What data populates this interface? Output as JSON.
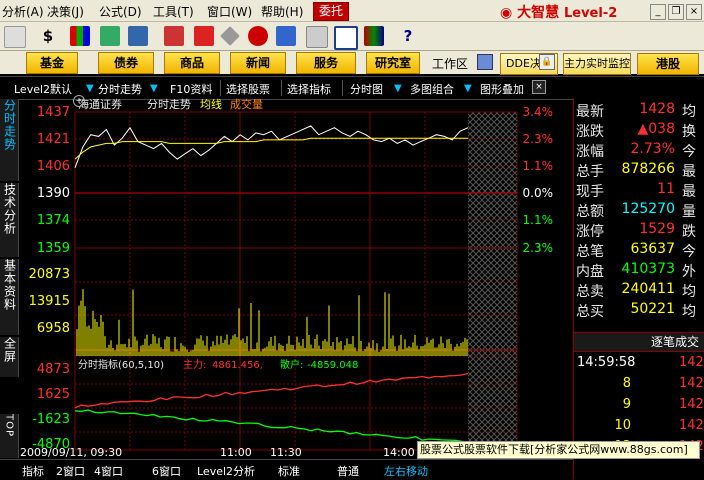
{
  "menu": {
    "items": [
      "分析(A)",
      "决策(J)",
      "公式(D)",
      "工具(T)",
      "窗口(W)",
      "帮助(H)"
    ],
    "entrust": "委托",
    "logo": "大智慧",
    "logo_level": "Level-2"
  },
  "toolbar": {
    "icons": [
      "ruler-icon",
      "dollar-icon",
      "quote-icon",
      "chart-icon",
      "news-icon",
      "flag-icon",
      "diamond-icon",
      "ie-icon",
      "lock-icon",
      "window-icon",
      "table-icon",
      "book-icon",
      "help-icon"
    ]
  },
  "nav": {
    "buttons": [
      "基金",
      "债券",
      "商品",
      "新闻",
      "服务",
      "研究室"
    ],
    "workarea": "工作区",
    "dde": "DDE决策",
    "realtime": "主力实时监控",
    "hk": "港股"
  },
  "funcbar": {
    "items": [
      "Level2默认",
      "分时走势",
      "F10资料",
      "选择股票",
      "选择指标",
      "分时图",
      "多图组合",
      "图形叠加"
    ]
  },
  "left_tabs": [
    "分时走势",
    "技术分析",
    "基本资料",
    "全屏",
    "TOP"
  ],
  "chart": {
    "stock_name": "海通证券",
    "view_name": "分时走势",
    "legend_avg": "均线",
    "legend_vol": "成交量",
    "price_ticks": [
      "1437",
      "1421",
      "1406",
      "1390",
      "1374",
      "1359"
    ],
    "pct_ticks": [
      "3.4%",
      "2.3%",
      "1.1%",
      "0.0%",
      "1.1%",
      "2.3%"
    ],
    "vol_ticks": [
      "20873",
      "13915",
      "6958"
    ],
    "indicator_title": "分时指标(60,5,10)",
    "indicator_main_label": "主力:",
    "indicator_main_value": "4861.456,",
    "indicator_retail_label": "散户:",
    "indicator_retail_value": "-4859.048",
    "ind_ticks": [
      "4873",
      "1625",
      "-1623",
      "-4870"
    ],
    "time_labels": [
      "2009/09/11, 09:30",
      "11:00",
      "11:30",
      "14:00"
    ]
  },
  "chart_data": {
    "type": "line",
    "title": "分时走势",
    "ylim": [
      1359,
      1437
    ],
    "series": [
      {
        "name": "价格",
        "values": [
          1405,
          1417,
          1424,
          1423,
          1427,
          1418,
          1422,
          1428,
          1420,
          1418,
          1416,
          1419,
          1414,
          1410,
          1413,
          1416,
          1412,
          1415,
          1419,
          1423,
          1420,
          1424,
          1421,
          1425,
          1424,
          1426,
          1421,
          1423,
          1425,
          1427,
          1429,
          1424,
          1426,
          1428,
          1425,
          1423,
          1426,
          1424,
          1421,
          1420,
          1422,
          1419,
          1421,
          1418,
          1420,
          1422,
          1424,
          1423,
          1421,
          1426,
          1428
        ]
      },
      {
        "name": "均线",
        "values": [
          1410,
          1414,
          1417,
          1418,
          1419,
          1419,
          1420,
          1420,
          1420,
          1420,
          1420,
          1420,
          1419,
          1419,
          1419,
          1419,
          1419,
          1419,
          1419,
          1420,
          1420,
          1420,
          1420,
          1420,
          1421,
          1421,
          1421,
          1421,
          1421,
          1421,
          1422,
          1422,
          1422,
          1422,
          1422,
          1422,
          1422,
          1422,
          1422,
          1422,
          1422,
          1422,
          1422,
          1422,
          1422,
          1422,
          1422,
          1422,
          1422,
          1422,
          1422
        ]
      }
    ]
  },
  "quote": {
    "rows": [
      {
        "label": "最新",
        "value": "1428",
        "color": "#ff3030",
        "right": "均"
      },
      {
        "label": "涨跌",
        "value": "▲038",
        "color": "#ff3030",
        "right": "换"
      },
      {
        "label": "涨幅",
        "value": "2.73%",
        "color": "#ff3030",
        "right": "今"
      },
      {
        "label": "总手",
        "value": "878266",
        "color": "#ffff00",
        "right": "最"
      },
      {
        "label": "现手",
        "value": "11",
        "color": "#ff3030",
        "right": "最"
      },
      {
        "label": "总额",
        "value": "125270",
        "color": "#00ffff",
        "right": "量"
      },
      {
        "label": "涨停",
        "value": "1529",
        "color": "#ff3030",
        "right": "跌"
      },
      {
        "label": "总笔",
        "value": "63637",
        "color": "#ffff00",
        "right": "今"
      },
      {
        "label": "内盘",
        "value": "410373",
        "color": "#00ff00",
        "right": "外"
      },
      {
        "label": "总卖",
        "value": "240411",
        "color": "#ffff00",
        "right": "均"
      },
      {
        "label": "总买",
        "value": "50221",
        "color": "#ffff00",
        "right": "均"
      }
    ],
    "trades_title": "逐笔成交",
    "trades": [
      {
        "time": "14:59:58",
        "vol": "",
        "price": "1429"
      },
      {
        "time": "",
        "vol": "8",
        "price": "1429"
      },
      {
        "time": "",
        "vol": "9",
        "price": "1429"
      },
      {
        "time": "",
        "vol": "10",
        "price": "1429"
      },
      {
        "time": "",
        "vol": "12",
        "price": "1429"
      }
    ]
  },
  "bottom": {
    "tabs": [
      "指标",
      "2窗口",
      "4窗口",
      "6窗口",
      "Level2分析",
      "标准",
      "普通",
      "左右移动"
    ]
  },
  "ad": "股票公式股票软件下载[分析家公式网www.88gs.com]"
}
